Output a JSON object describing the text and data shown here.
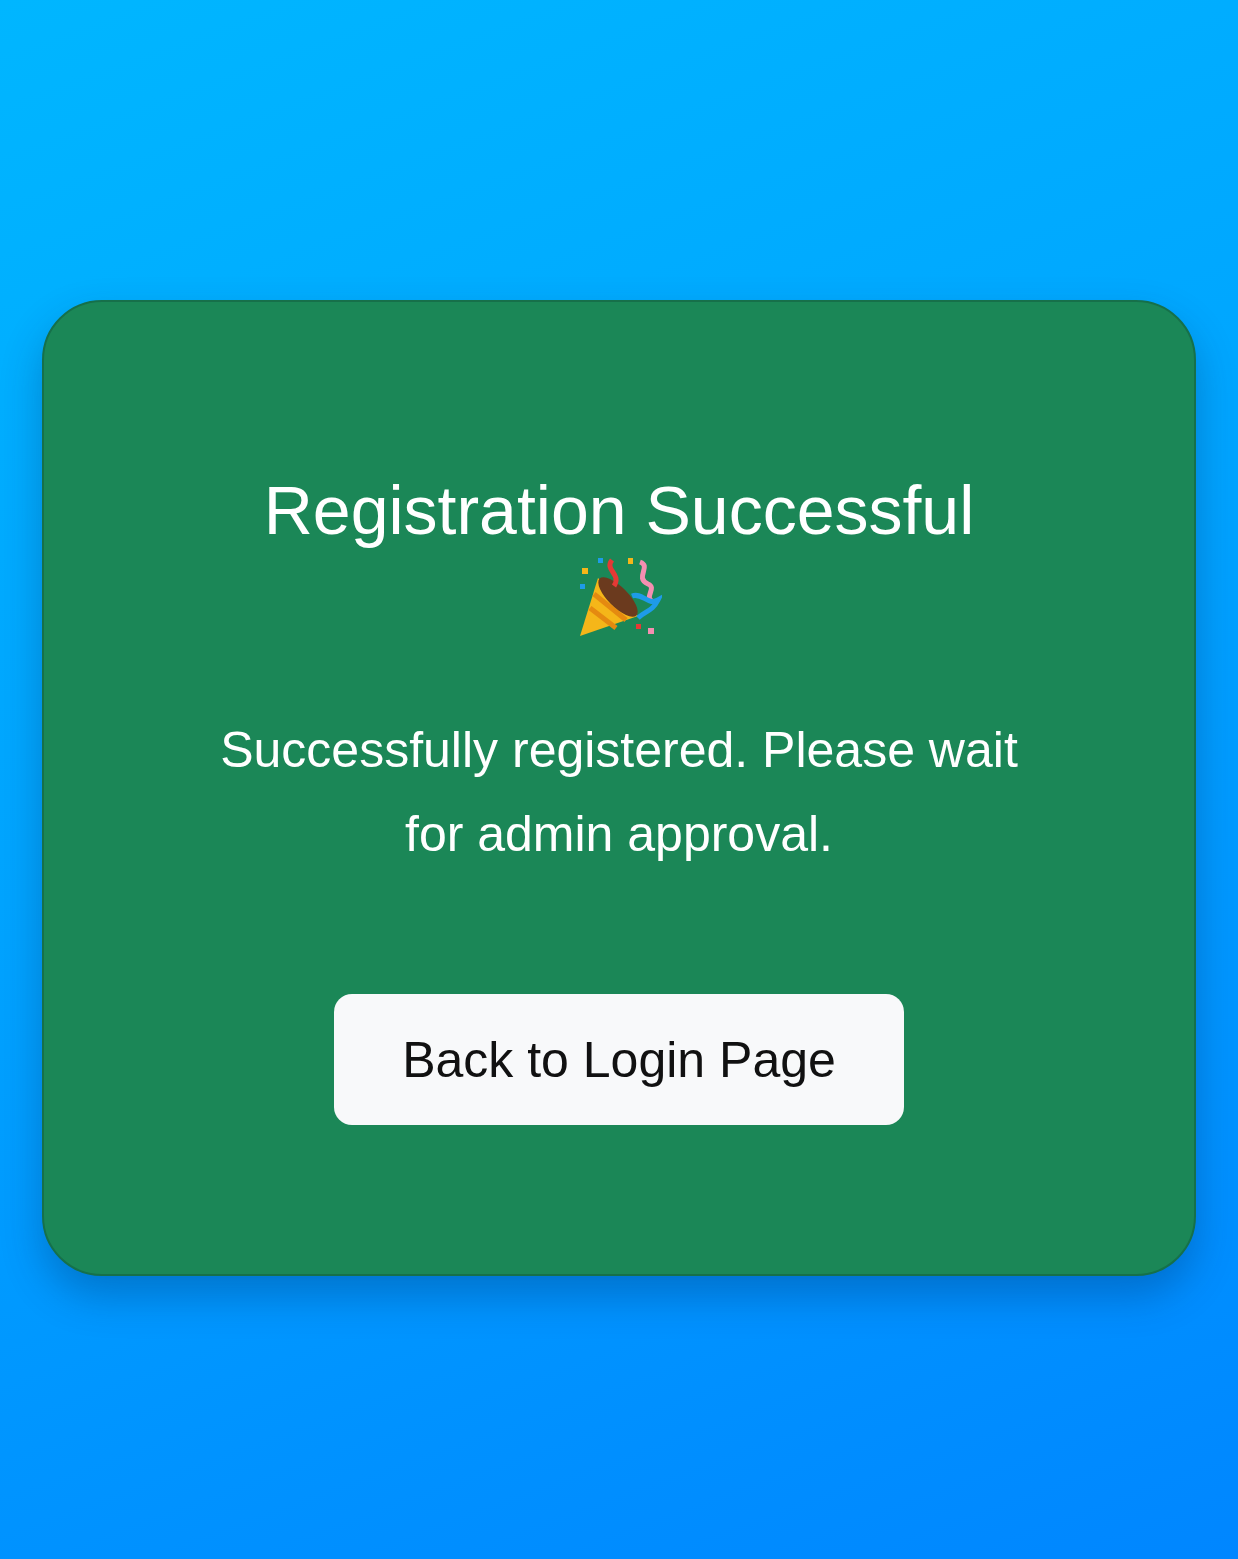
{
  "card": {
    "title": "Registration Successful",
    "message": "Successfully registered. Please wait for admin approval.",
    "button": "Back to Login Page"
  }
}
